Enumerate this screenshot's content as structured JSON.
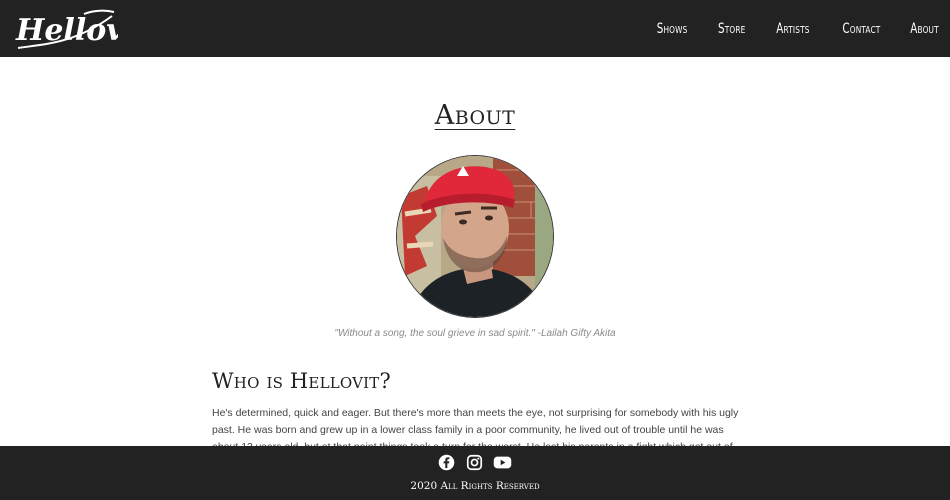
{
  "header": {
    "logo_text": "Hellovit",
    "nav": [
      {
        "label": "Shows"
      },
      {
        "label": "Store"
      },
      {
        "label": "Artists"
      },
      {
        "label": "Contact"
      },
      {
        "label": "About"
      }
    ]
  },
  "main": {
    "title": "About",
    "quote": "\"Without a song, the soul grieve in sad spirit.\" -Lailah Gifty Akita",
    "section_title": "Who is Hellovit?",
    "paragraph": "He's determined, quick and eager. But there's more than meets the eye, not surprising for somebody with his ugly past. He was born and grew up in a lower class family in a poor community, he lived out of trouble until he was about 13 years old, but at that point things took a turn for the worst. He lost his parents in a fight which got out of control and"
  },
  "footer": {
    "social": [
      {
        "icon": "facebook-icon"
      },
      {
        "icon": "instagram-icon"
      },
      {
        "icon": "youtube-icon"
      }
    ],
    "copyright": "2020 All Rights Reserved"
  },
  "colors": {
    "bar": "#222222",
    "text": "#444444",
    "quote": "#8a8a8a",
    "cap": "#e0283a"
  }
}
